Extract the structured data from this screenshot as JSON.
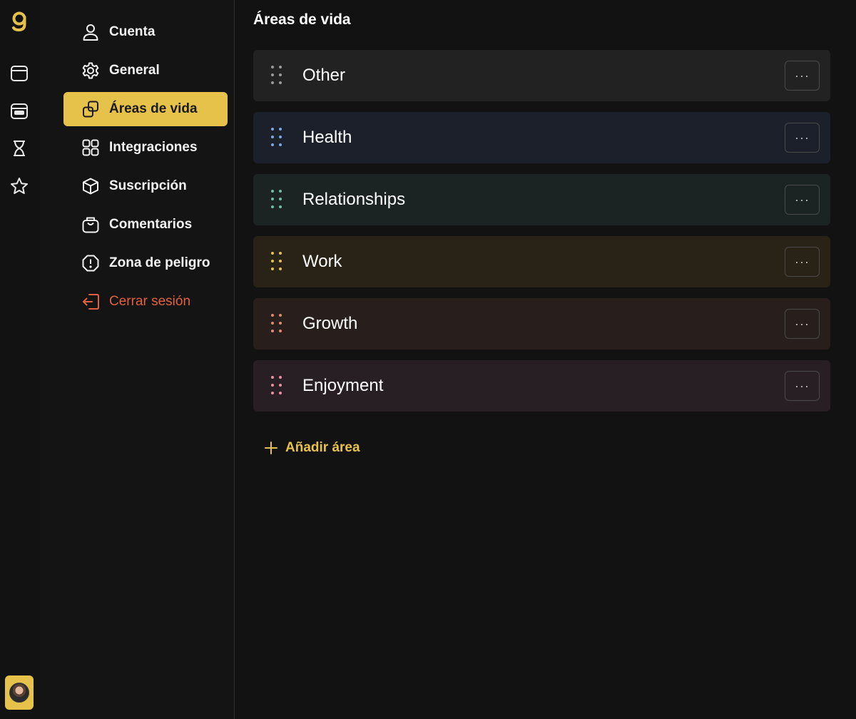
{
  "app": {
    "accent": "#e6c24a",
    "danger_color": "#e0623f"
  },
  "rail": {
    "items": [
      {
        "name": "calendar-icon"
      },
      {
        "name": "agenda-icon"
      },
      {
        "name": "hourglass-icon"
      },
      {
        "name": "star-icon"
      }
    ]
  },
  "settings_nav": {
    "items": [
      {
        "label": "Cuenta",
        "icon": "user-icon"
      },
      {
        "label": "General",
        "icon": "gear-icon"
      },
      {
        "label": "Áreas de vida",
        "icon": "squares-icon",
        "active": true
      },
      {
        "label": "Integraciones",
        "icon": "grid-icon"
      },
      {
        "label": "Suscripción",
        "icon": "box-icon"
      },
      {
        "label": "Comentarios",
        "icon": "feedback-icon"
      },
      {
        "label": "Zona de peligro",
        "icon": "alert-icon"
      },
      {
        "label": "Cerrar sesión",
        "icon": "logout-icon"
      }
    ]
  },
  "main": {
    "title": "Áreas de vida",
    "areas": [
      {
        "name": "Other",
        "dot_color": "#9a9a9a",
        "bg_color": "#222222"
      },
      {
        "name": "Health",
        "dot_color": "#7fa7e6",
        "bg_color": "#1c202a"
      },
      {
        "name": "Relationships",
        "dot_color": "#6fbfa6",
        "bg_color": "#1c2323"
      },
      {
        "name": "Work",
        "dot_color": "#e6c24a",
        "bg_color": "#282316"
      },
      {
        "name": "Growth",
        "dot_color": "#e38a6a",
        "bg_color": "#281e1c"
      },
      {
        "name": "Enjoyment",
        "dot_color": "#e8909e",
        "bg_color": "#281f24"
      }
    ],
    "more_label": "···",
    "add_label": "Añadir área"
  }
}
